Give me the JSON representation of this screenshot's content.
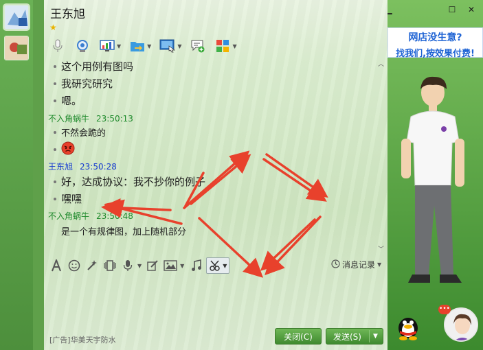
{
  "window": {
    "title": "王东旭",
    "star": "★"
  },
  "sidebar": {
    "avatars": [
      {
        "name": "contact-avatar-active"
      },
      {
        "name": "contact-avatar-2"
      }
    ]
  },
  "toolbar": {
    "icons": [
      "microphone-icon",
      "webcam-icon",
      "screen-share-icon",
      "file-transfer-icon",
      "remote-desktop-icon",
      "add-chat-icon",
      "apps-icon"
    ]
  },
  "messages": [
    {
      "type": "text",
      "text": "这个用例有图吗"
    },
    {
      "type": "text",
      "text": "我研究研究"
    },
    {
      "type": "text",
      "text": "嗯。"
    },
    {
      "type": "sender",
      "name": "不入角蜗牛",
      "time": "23:50:13",
      "color": "#1f8a2c"
    },
    {
      "type": "text",
      "text": "不然会跪的"
    },
    {
      "type": "emoji",
      "name": "angry-face-icon"
    },
    {
      "type": "sender",
      "name": "王东旭",
      "time": "23:50:28",
      "color": "#1a3fd0"
    },
    {
      "type": "text",
      "text": "好，达成协议：我不抄你的例子"
    },
    {
      "type": "text",
      "text": "嘿嘿"
    },
    {
      "type": "sender",
      "name": "不入角蜗牛",
      "time": "23:50:48",
      "color": "#1f8a2c"
    },
    {
      "type": "plain",
      "text": "是一个有规律图，加上随机部分"
    }
  ],
  "input_toolbar": {
    "history_label": "消息记录"
  },
  "footer": {
    "ad_text": "[广告]华美天宇防水",
    "close_label": "关闭(C)",
    "send_label": "发送(S)"
  },
  "right_panel": {
    "banner_line1": "网店没生意?",
    "banner_line2": "找我们,按效果付费!"
  },
  "colors": {
    "arrow": "#e8412c",
    "green_sender": "#1f8a2c",
    "blue_sender": "#1a3fd0",
    "accent_green": "#4a9a3a"
  }
}
